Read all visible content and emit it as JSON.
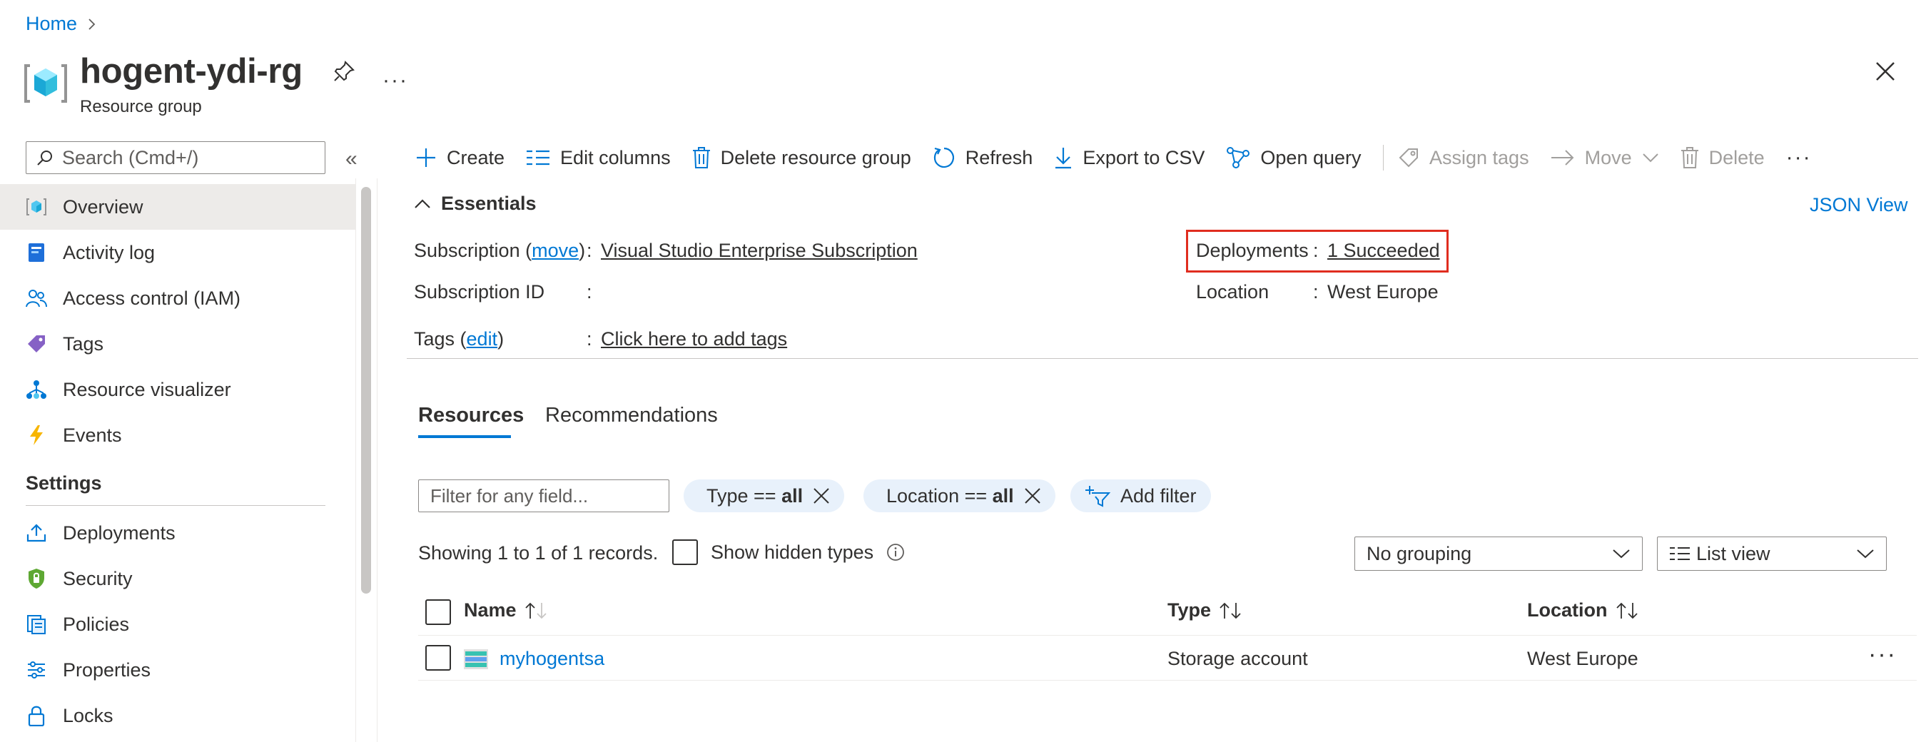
{
  "breadcrumb": {
    "home": "Home",
    "chevron": "›"
  },
  "header": {
    "title": "hogent-ydi-rg",
    "subtitle": "Resource group",
    "more": "···"
  },
  "search": {
    "placeholder": "Search (Cmd+/)",
    "collapse": "«"
  },
  "nav": {
    "items": [
      {
        "label": "Overview",
        "icon": "resource-group-icon"
      },
      {
        "label": "Activity log",
        "icon": "activity-log-icon"
      },
      {
        "label": "Access control (IAM)",
        "icon": "people-icon"
      },
      {
        "label": "Tags",
        "icon": "tag-icon"
      },
      {
        "label": "Resource visualizer",
        "icon": "hierarchy-icon"
      },
      {
        "label": "Events",
        "icon": "lightning-icon"
      }
    ],
    "settings_heading": "Settings",
    "settings_items": [
      {
        "label": "Deployments",
        "icon": "upload-icon"
      },
      {
        "label": "Security",
        "icon": "shield-icon"
      },
      {
        "label": "Policies",
        "icon": "policy-icon"
      },
      {
        "label": "Properties",
        "icon": "sliders-icon"
      },
      {
        "label": "Locks",
        "icon": "lock-icon"
      }
    ]
  },
  "toolbar": {
    "create": "Create",
    "edit_columns": "Edit columns",
    "delete_rg": "Delete resource group",
    "refresh": "Refresh",
    "export_csv": "Export to CSV",
    "open_query": "Open query",
    "assign_tags": "Assign tags",
    "move": "Move",
    "delete": "Delete",
    "more": "···"
  },
  "essentials": {
    "title": "Essentials",
    "json_view": "JSON View",
    "colon": ":",
    "subscription_label_pre": "Subscription (",
    "subscription_move": "move",
    "subscription_label_post": ")",
    "subscription_value": "Visual Studio Enterprise Subscription",
    "subscription_id_label": "Subscription ID",
    "subscription_id_value": "",
    "tags_label_pre": "Tags (",
    "tags_edit": "edit",
    "tags_label_post": ")",
    "tags_value": "Click here to add tags",
    "deployments_label": "Deployments",
    "deployments_value": "1 Succeeded",
    "location_label": "Location",
    "location_value": "West Europe"
  },
  "tabs": {
    "resources": "Resources",
    "recommendations": "Recommendations"
  },
  "filters": {
    "placeholder": "Filter for any field...",
    "type_pill_pre": "Type == ",
    "type_pill_value": "all",
    "location_pill_pre": "Location == ",
    "location_pill_value": "all",
    "add_filter": "Add filter"
  },
  "records": {
    "showing": "Showing 1 to 1 of 1 records.",
    "show_hidden": "Show hidden types",
    "grouping": "No grouping",
    "view": "List view"
  },
  "table": {
    "columns": {
      "name": "Name",
      "type": "Type",
      "location": "Location"
    },
    "rows": [
      {
        "name": "myhogentsa",
        "type": "Storage account",
        "location": "West Europe"
      }
    ],
    "row_more": "···"
  },
  "colors": {
    "accent": "#0078d4",
    "highlight": "#e02d1f",
    "pill_bg": "#e8f1fb"
  }
}
